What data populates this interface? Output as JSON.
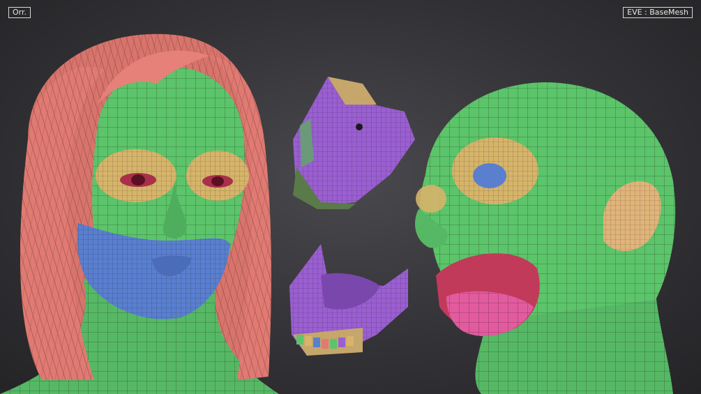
{
  "viewport": {
    "projection_label": "Orr.",
    "mesh_label": "EVE : BaseMesh"
  },
  "polygroup_colors": {
    "hair": "#e07a72",
    "skin": "#5cc46a",
    "eye_socket": "#d6b46a",
    "lips_chin": "#5a7fcf",
    "eyeball": "#a8304a",
    "mouth_interior": "#9a5fd0",
    "tongue": "#e25b9f",
    "ear": "#e0b47a"
  }
}
